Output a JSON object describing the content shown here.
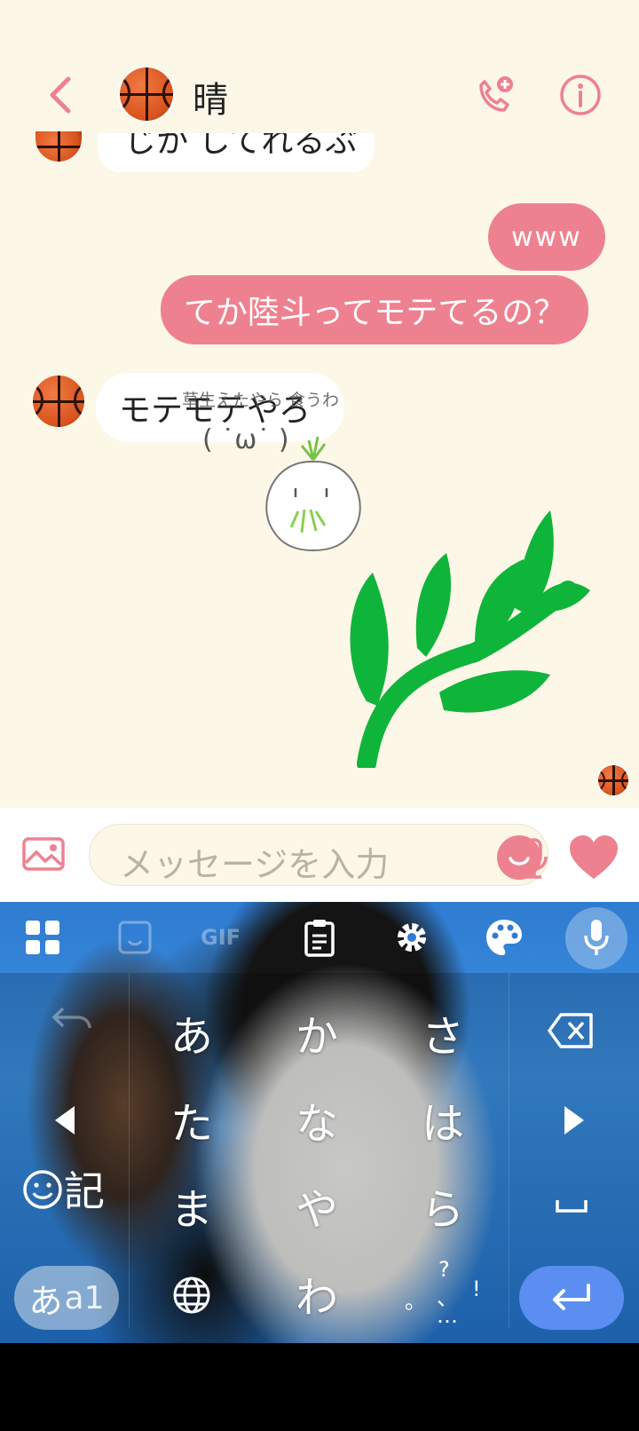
{
  "header": {
    "contact_name": "晴",
    "back_icon": "chevron-left-icon",
    "call_icon": "phone-add-icon",
    "info_icon": "info-icon"
  },
  "messages": {
    "partial_incoming": "じか してれるぶ",
    "outgoing_1": "www",
    "outgoing_2": "てか陸斗ってモテてるの？",
    "incoming_1": "モテモテやろ",
    "sticker_caption": "草生えたやら 食うわ",
    "sticker_face": "( ˙ω˙ )"
  },
  "input_bar": {
    "placeholder": "メッセージを入力",
    "image_icon": "image-icon",
    "mic_icon": "mic-icon",
    "emoji_icon": "smiley-icon",
    "like_icon": "heart-icon"
  },
  "keyboard": {
    "toolbar": [
      "apps-icon",
      "sticker-icon",
      "GIF",
      "clipboard-icon",
      "gear-icon",
      "palette-icon",
      "mic-icon"
    ],
    "gif_label": "GIF",
    "keys": {
      "a": "あ",
      "ka": "か",
      "sa": "さ",
      "ta": "た",
      "na": "な",
      "ha": "は",
      "ma": "ま",
      "ya": "や",
      "ra": "ら",
      "wa": "わ"
    },
    "kigou_label": "記",
    "mode_hira": "あ",
    "mode_alpha": "a1",
    "punct_top": "?",
    "punct_left": "。",
    "punct_mid": "、",
    "punct_right": "!",
    "punct_bottom": "…"
  },
  "colors": {
    "accent": "#ee8190",
    "chat_bg": "#fdf7e8",
    "enter": "#5b8ef0",
    "leaf": "#0fb43a"
  }
}
